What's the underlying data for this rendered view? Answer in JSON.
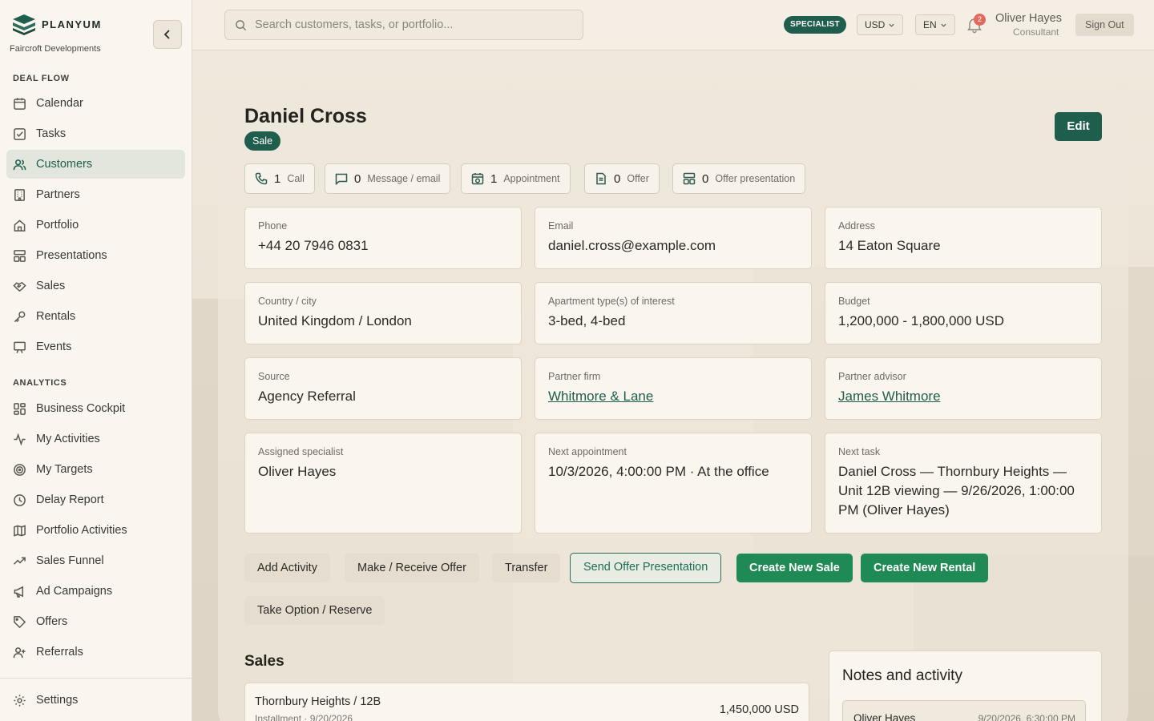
{
  "brand": {
    "name": "PLANYUM",
    "org": "Faircroft Developments"
  },
  "sidebar": {
    "sections": [
      {
        "label": "DEAL FLOW",
        "items": [
          {
            "label": "Calendar",
            "icon": "calendar-icon"
          },
          {
            "label": "Tasks",
            "icon": "tasks-icon"
          },
          {
            "label": "Customers",
            "icon": "users-icon",
            "active": true
          },
          {
            "label": "Partners",
            "icon": "building-icon"
          },
          {
            "label": "Portfolio",
            "icon": "home-icon"
          },
          {
            "label": "Presentations",
            "icon": "layout-icon"
          },
          {
            "label": "Sales",
            "icon": "handshake-icon"
          },
          {
            "label": "Rentals",
            "icon": "key-icon"
          },
          {
            "label": "Events",
            "icon": "presentation-icon"
          }
        ]
      },
      {
        "label": "ANALYTICS",
        "items": [
          {
            "label": "Business Cockpit",
            "icon": "grid-icon"
          },
          {
            "label": "My Activities",
            "icon": "activity-icon"
          },
          {
            "label": "My Targets",
            "icon": "target-icon"
          },
          {
            "label": "Delay Report",
            "icon": "clock-icon"
          },
          {
            "label": "Portfolio Activities",
            "icon": "map-icon"
          },
          {
            "label": "Sales Funnel",
            "icon": "trending-icon"
          },
          {
            "label": "Ad Campaigns",
            "icon": "megaphone-icon"
          },
          {
            "label": "Offers",
            "icon": "tag-icon"
          },
          {
            "label": "Referrals",
            "icon": "user-plus-icon"
          }
        ]
      }
    ],
    "settings": {
      "label": "Settings",
      "icon": "gear-icon"
    }
  },
  "topbar": {
    "search_placeholder": "Search customers, tasks, or portfolio...",
    "role": "SPECIALIST",
    "currency": "USD",
    "language": "EN",
    "notifications": "2",
    "user_name": "Oliver Hayes",
    "user_role": "Consultant",
    "sign_out": "Sign Out"
  },
  "customer": {
    "name": "Daniel Cross",
    "type": "Sale",
    "edit_label": "Edit",
    "stats": [
      {
        "num": "1",
        "label": "Call",
        "icon": "phone-icon"
      },
      {
        "num": "0",
        "label": "Message / email",
        "icon": "message-icon"
      },
      {
        "num": "1",
        "label": "Appointment",
        "icon": "calendar-clock-icon"
      },
      {
        "num": "0",
        "label": "Offer",
        "icon": "document-icon"
      },
      {
        "num": "0",
        "label": "Offer presentation",
        "icon": "layout-icon"
      }
    ],
    "fields": [
      {
        "k": "Phone",
        "v": "+44 20 7946 0831"
      },
      {
        "k": "Email",
        "v": "daniel.cross@example.com"
      },
      {
        "k": "Address",
        "v": "14 Eaton Square"
      },
      {
        "k": "Country / city",
        "v": "United Kingdom / London"
      },
      {
        "k": "Apartment type(s) of interest",
        "v": "3-bed, 4-bed"
      },
      {
        "k": "Budget",
        "v": "1,200,000 - 1,800,000 USD"
      },
      {
        "k": "Source",
        "v": "Agency Referral"
      },
      {
        "k": "Partner firm",
        "v": "Whitmore & Lane",
        "link": true
      },
      {
        "k": "Partner advisor",
        "v": "James Whitmore",
        "link": true
      },
      {
        "k": "Assigned specialist",
        "v": "Oliver Hayes"
      },
      {
        "k": "Next appointment",
        "v": "10/3/2026, 4:00:00 PM · At the office"
      },
      {
        "k": "Next task",
        "v": "Daniel Cross — Thornbury Heights — Unit 12B viewing — 9/26/2026, 1:00:00 PM (Oliver Hayes)"
      }
    ]
  },
  "actions": [
    {
      "label": "Add Activity",
      "style": "neutral"
    },
    {
      "label": "Make / Receive Offer",
      "style": "neutral"
    },
    {
      "label": "Transfer",
      "style": "neutral"
    },
    {
      "label": "Send Offer Presentation",
      "style": "outline"
    },
    {
      "label": "Create New Sale",
      "style": "green"
    },
    {
      "label": "Create New Rental",
      "style": "green"
    },
    {
      "label": "Take Option / Reserve",
      "style": "neutral"
    }
  ],
  "sales": {
    "title": "Sales",
    "items": [
      {
        "property": "Thornbury Heights / 12B",
        "meta": "Installment · 9/20/2026",
        "amount": "1,450,000 USD"
      }
    ]
  },
  "notes": {
    "title": "Notes and activity",
    "items": [
      {
        "author": "Oliver Hayes",
        "time": "9/20/2026, 6:30:00 PM"
      }
    ]
  },
  "colors": {
    "accent": "#1f5d4c",
    "green": "#1f8a55",
    "badge_red": "#e26a5a"
  }
}
